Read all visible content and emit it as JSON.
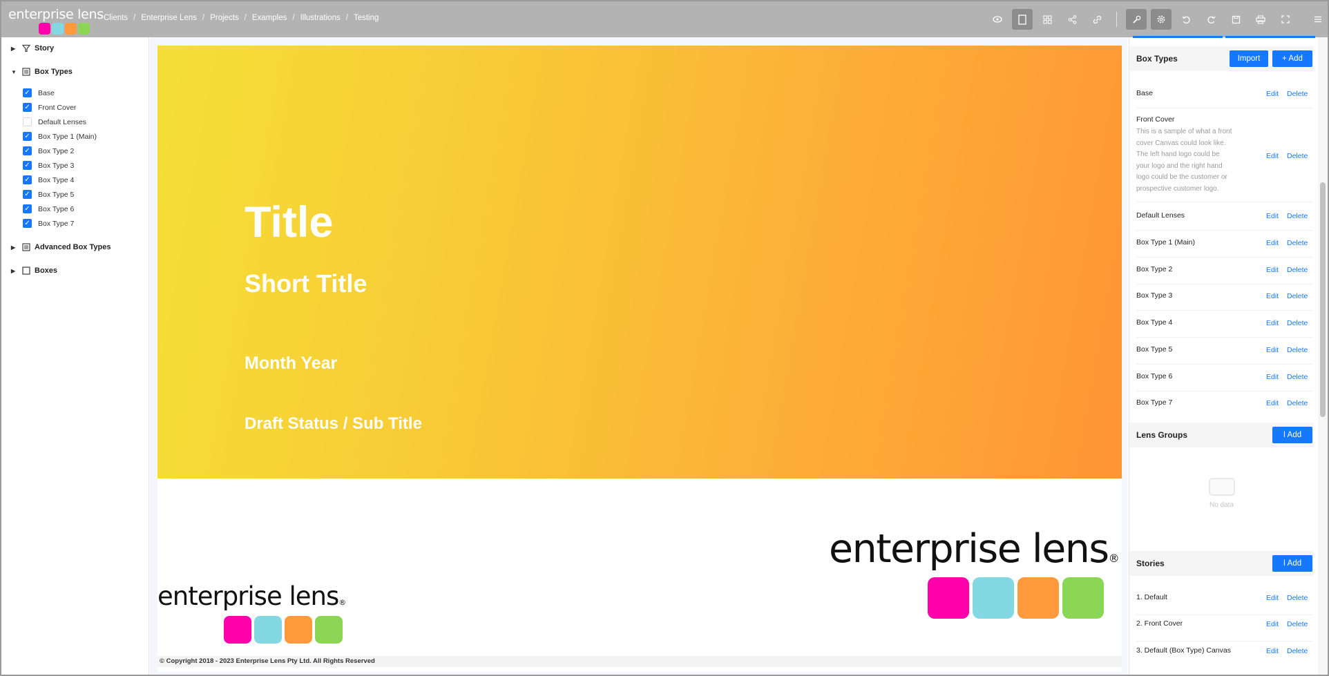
{
  "app": {
    "logo_text": "enterprise lens",
    "logo_colors": [
      "#ff00aa",
      "#84d8e4",
      "#ff9a3c",
      "#8bd655"
    ]
  },
  "breadcrumb": [
    "Clients",
    "Enterprise Lens",
    "Projects",
    "Examples",
    "Illustrations",
    "Testing"
  ],
  "breadcrumb_sep": "/",
  "toolbar": {
    "icons": [
      "eye-icon",
      "page-icon",
      "grid-icon",
      "share-icon",
      "link-icon",
      "wrench-icon",
      "gear-icon",
      "undo-icon",
      "redo-icon",
      "save-icon",
      "print-icon",
      "fullscreen-icon",
      "menu-icon"
    ]
  },
  "tree": {
    "story": "Story",
    "box_types": "Box Types",
    "items": [
      {
        "label": "Base",
        "checked": true
      },
      {
        "label": "Front Cover",
        "checked": true
      },
      {
        "label": "Default Lenses",
        "checked": false
      },
      {
        "label": "Box Type 1 (Main)",
        "checked": true
      },
      {
        "label": "Box Type 2",
        "checked": true
      },
      {
        "label": "Box Type 3",
        "checked": true
      },
      {
        "label": "Box Type 4",
        "checked": true
      },
      {
        "label": "Box Type 5",
        "checked": true
      },
      {
        "label": "Box Type 6",
        "checked": true
      },
      {
        "label": "Box Type 7",
        "checked": true
      }
    ],
    "advanced": "Advanced Box Types",
    "boxes": "Boxes"
  },
  "cover": {
    "title": "Title",
    "short_title": "Short Title",
    "month_year": "Month Year",
    "draft": "Draft Status / Sub Title",
    "brand_text": "enterprise lens",
    "brand_reg": "®",
    "copyright": "© Copyright 2018 - 2023 Enterprise Lens Pty Ltd. All Rights Reserved"
  },
  "right_panel": {
    "box_types_header": "Box Types",
    "import_label": "Import",
    "add_label": "+ Add",
    "edit_label": "Edit",
    "delete_label": "Delete",
    "front_cover_desc": "This is a sample of what a front cover Canvas could look like. The left hand logo could be your logo and the right hand logo could be the customer or prospective customer logo.",
    "box_types": [
      "Base",
      "Front Cover",
      "Default Lenses",
      "Box Type 1 (Main)",
      "Box Type 2",
      "Box Type 3",
      "Box Type 4",
      "Box Type 5",
      "Box Type 6",
      "Box Type 7"
    ],
    "lens_groups_header": "Lens Groups",
    "lens_add_label": "I Add",
    "no_data": "No data",
    "stories_header": "Stories",
    "stories_add_label": "I Add",
    "stories": [
      "1. Default",
      "2. Front Cover",
      "3. Default (Box Type) Canvas"
    ]
  }
}
